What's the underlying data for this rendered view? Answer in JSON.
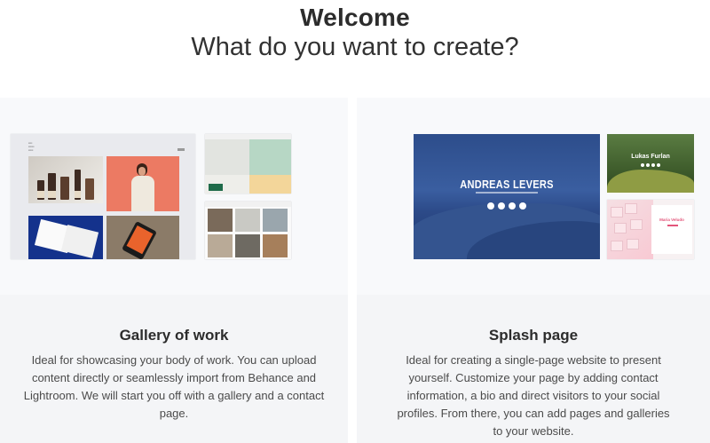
{
  "header": {
    "title": "Welcome",
    "subtitle": "What do you want to create?"
  },
  "options": [
    {
      "title": "Gallery of work",
      "description": "Ideal for showcasing your body of work. You can upload content directly or seamlessly import from Behance and Lightroom. We will start you off with a gallery and a contact page."
    },
    {
      "title": "Splash page",
      "description": "Ideal for creating a single-page website to present yourself. Customize your page by adding contact information, a bio and direct visitors to your social profiles. From there, you can add pages and galleries to your website.",
      "preview": {
        "main_name": "ANDREAS LEVERS",
        "side_name_1": "Lukas Furlan",
        "side_name_2": "Maria Veludo"
      }
    }
  ]
}
